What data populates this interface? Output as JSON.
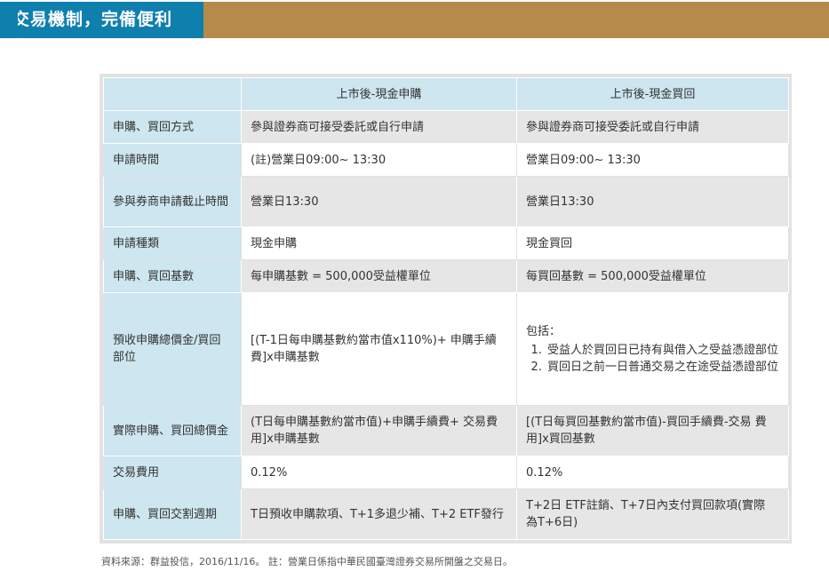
{
  "header": {
    "title": "交易機制，完備便利"
  },
  "table": {
    "columns": [
      "",
      "上市後-現金申購",
      "上市後-現金買回"
    ],
    "rows": [
      {
        "label": "申購、買回方式",
        "purchase": "參與證券商可接受委託或自行申請",
        "redemption": "參與證券商可接受委託或自行申請"
      },
      {
        "label": "申請時間",
        "purchase": "(註)營業日09:00~ 13:30",
        "redemption": "營業日09:00~ 13:30"
      },
      {
        "label": "參與券商申請截止時間",
        "purchase": "營業日13:30",
        "redemption": "營業日13:30"
      },
      {
        "label": "申請種類",
        "purchase": "現金申購",
        "redemption": "現金買回"
      },
      {
        "label": "申購、買回基數",
        "purchase": "每申購基數 = 500,000受益權單位",
        "redemption": "每買回基數 = 500,000受益權單位"
      },
      {
        "label": "預收申購總價金/買回部位",
        "purchase": "[(T-1日每申購基數約當市值x110%)+ 申購手續費]x申購基數",
        "redemption_intro": "包括：",
        "redemption_items": [
          "受益人於買回日已持有與借入之受益憑證部位",
          "買回日之前一日普通交易之在途受益憑證部位"
        ]
      },
      {
        "label": "實際申購、買回總價金",
        "purchase": "(T日每申購基數約當市值)+申購手續費+ 交易費用]x申購基數",
        "redemption": "[(T日每買回基數約當市值)-買回手續費-交易 費用]x買回基數"
      },
      {
        "label": "交易費用",
        "purchase": "0.12%",
        "redemption": "0.12%"
      },
      {
        "label": "申購、買回交割週期",
        "purchase": "T日預收申購款項、T+1多退少補、T+2 ETF發行",
        "redemption": "T+2日 ETF註銷、T+7日內支付買回款項(實際 為T+6日)"
      }
    ]
  },
  "footnote": "資料來源：群益投信，2016/11/16。 註：營業日係指中華民國臺灣證券交易所開盤之交易日。",
  "colors": {
    "title_blue": "#0f7fae",
    "bar_gold": "#b58a4a",
    "header_cell": "#cde6ef",
    "grey_cell": "#e6e6e6"
  }
}
